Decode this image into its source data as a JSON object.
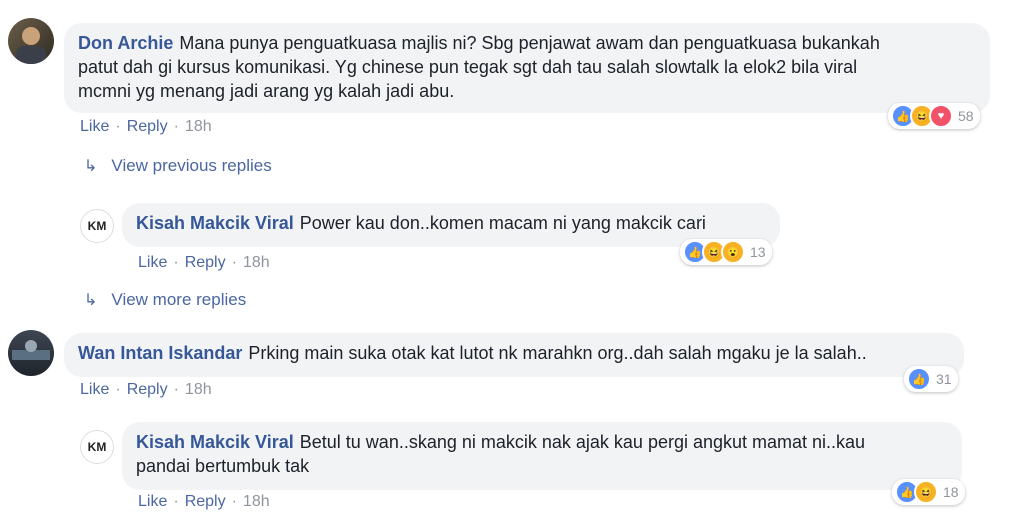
{
  "comments": [
    {
      "name": "Don Archie",
      "text_line1": "Mana punya penguatkuasa majlis ni? Sbg penjawat awam dan penguatkuasa bukankah",
      "text_line2": "patut dah gi kursus komunikasi. Yg chinese pun tegak sgt dah tau salah slowtalk la elok2 bila viral",
      "text_line3": "mcmni yg menang jadi arang yg kalah jadi abu.",
      "like": "Like",
      "reply": "Reply",
      "time": "18h",
      "reaction_count": "58"
    },
    {
      "name": "Kisah Makcik Viral",
      "text_line1": "Power kau don..komen macam ni yang makcik cari",
      "like": "Like",
      "reply": "Reply",
      "time": "18h",
      "reaction_count": "13"
    },
    {
      "name": "Wan Intan Iskandar",
      "text_line1": "Prking main suka otak kat lutot nk marahkn org..dah salah mgaku je la salah..",
      "like": "Like",
      "reply": "Reply",
      "time": "18h",
      "reaction_count": "31"
    },
    {
      "name": "Kisah Makcik Viral",
      "text_line1": "Betul tu wan..skang ni makcik nak ajak kau pergi angkut mamat ni..kau",
      "text_line2": "pandai bertumbuk tak",
      "like": "Like",
      "reply": "Reply",
      "time": "18h",
      "reaction_count": "18"
    }
  ],
  "view_previous": "View previous replies",
  "view_more": "View more replies",
  "page_logo_text": "KM",
  "colors": {
    "link": "#365899",
    "bubble": "#f2f3f5",
    "like": "#5890ff"
  }
}
